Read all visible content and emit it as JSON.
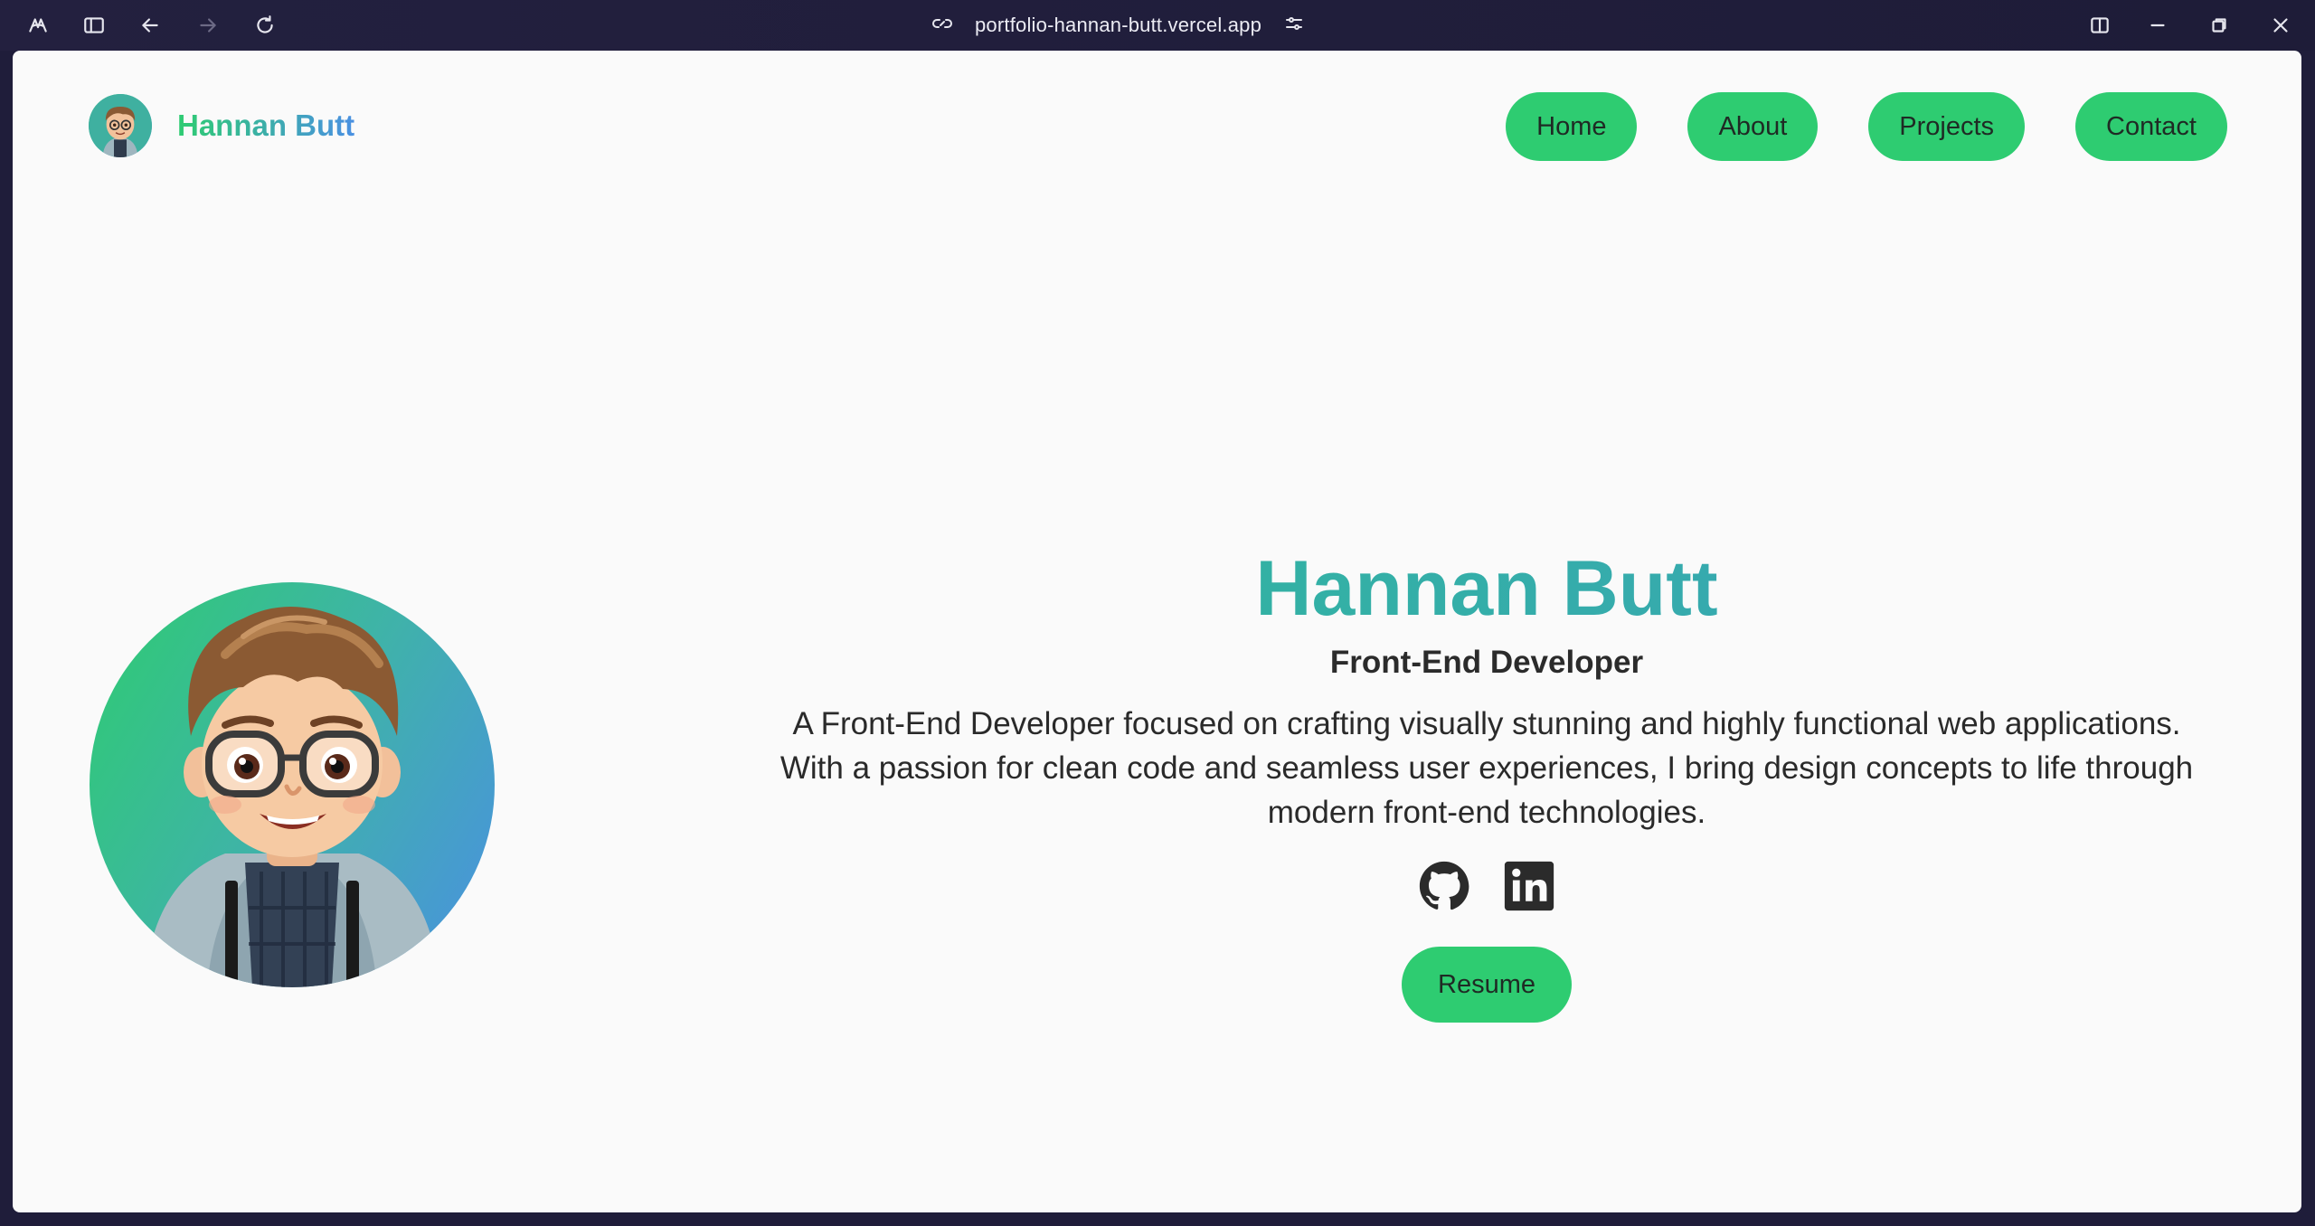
{
  "browser": {
    "url": "portfolio-hannan-butt.vercel.app",
    "icons": {
      "app": "browser-logo-icon",
      "sidebar": "sidebar-toggle-icon",
      "back": "back-arrow-icon",
      "forward": "forward-arrow-icon",
      "reload": "reload-icon",
      "link": "link-icon",
      "settings": "site-settings-icon",
      "split": "split-view-icon",
      "minimize": "minimize-icon",
      "restore": "restore-icon",
      "close": "close-icon"
    }
  },
  "header": {
    "brand_name": "Hannan Butt",
    "nav": [
      {
        "label": "Home"
      },
      {
        "label": "About"
      },
      {
        "label": "Projects"
      },
      {
        "label": "Contact"
      }
    ]
  },
  "hero": {
    "name": "Hannan Butt",
    "role": "Front-End Developer",
    "description": "A Front-End Developer focused on crafting visually stunning and highly functional web applications. With a passion for clean code and seamless user experiences, I bring design concepts to life through modern front-end technologies.",
    "socials": [
      {
        "icon": "github-icon"
      },
      {
        "icon": "linkedin-icon"
      }
    ],
    "resume_label": "Resume"
  },
  "colors": {
    "accent": "#2ecc71",
    "gradient_end": "#4a90e2",
    "page_bg": "#fafafa",
    "chrome_bg": "#23203f"
  }
}
